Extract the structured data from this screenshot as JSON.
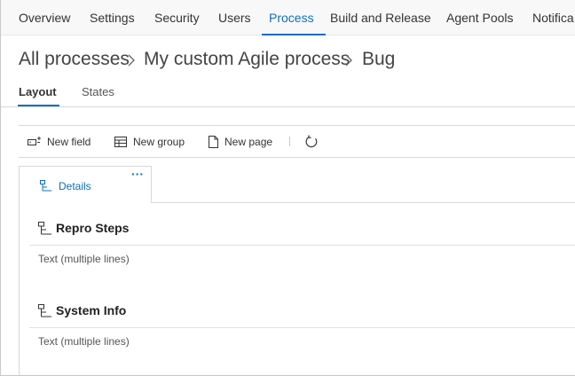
{
  "nav": {
    "items": [
      {
        "label": "Overview",
        "active": false
      },
      {
        "label": "Settings",
        "active": false
      },
      {
        "label": "Security",
        "active": false
      },
      {
        "label": "Users",
        "active": false
      },
      {
        "label": "Process",
        "active": true
      },
      {
        "label": "Build and Release",
        "active": false
      },
      {
        "label": "Agent Pools",
        "active": false
      },
      {
        "label": "Notifica",
        "active": false
      }
    ]
  },
  "breadcrumb": {
    "items": [
      "All processes",
      "My custom Agile process",
      "Bug"
    ],
    "separator_icon": "chevron-right-icon"
  },
  "subtabs": {
    "items": [
      {
        "label": "Layout",
        "active": true
      },
      {
        "label": "States",
        "active": false
      }
    ]
  },
  "toolbar": {
    "new_field": "New field",
    "new_group": "New group",
    "new_page": "New page",
    "refresh_icon": "refresh-icon"
  },
  "page_tab": {
    "label": "Details",
    "more": "···"
  },
  "groups": [
    {
      "title": "Repro Steps",
      "field": "Text (multiple lines)"
    },
    {
      "title": "System Info",
      "field": "Text (multiple lines)"
    }
  ],
  "colors": {
    "accent": "#106ebe",
    "nav_background": "#f8f8f8",
    "border": "#d8d8d8"
  }
}
